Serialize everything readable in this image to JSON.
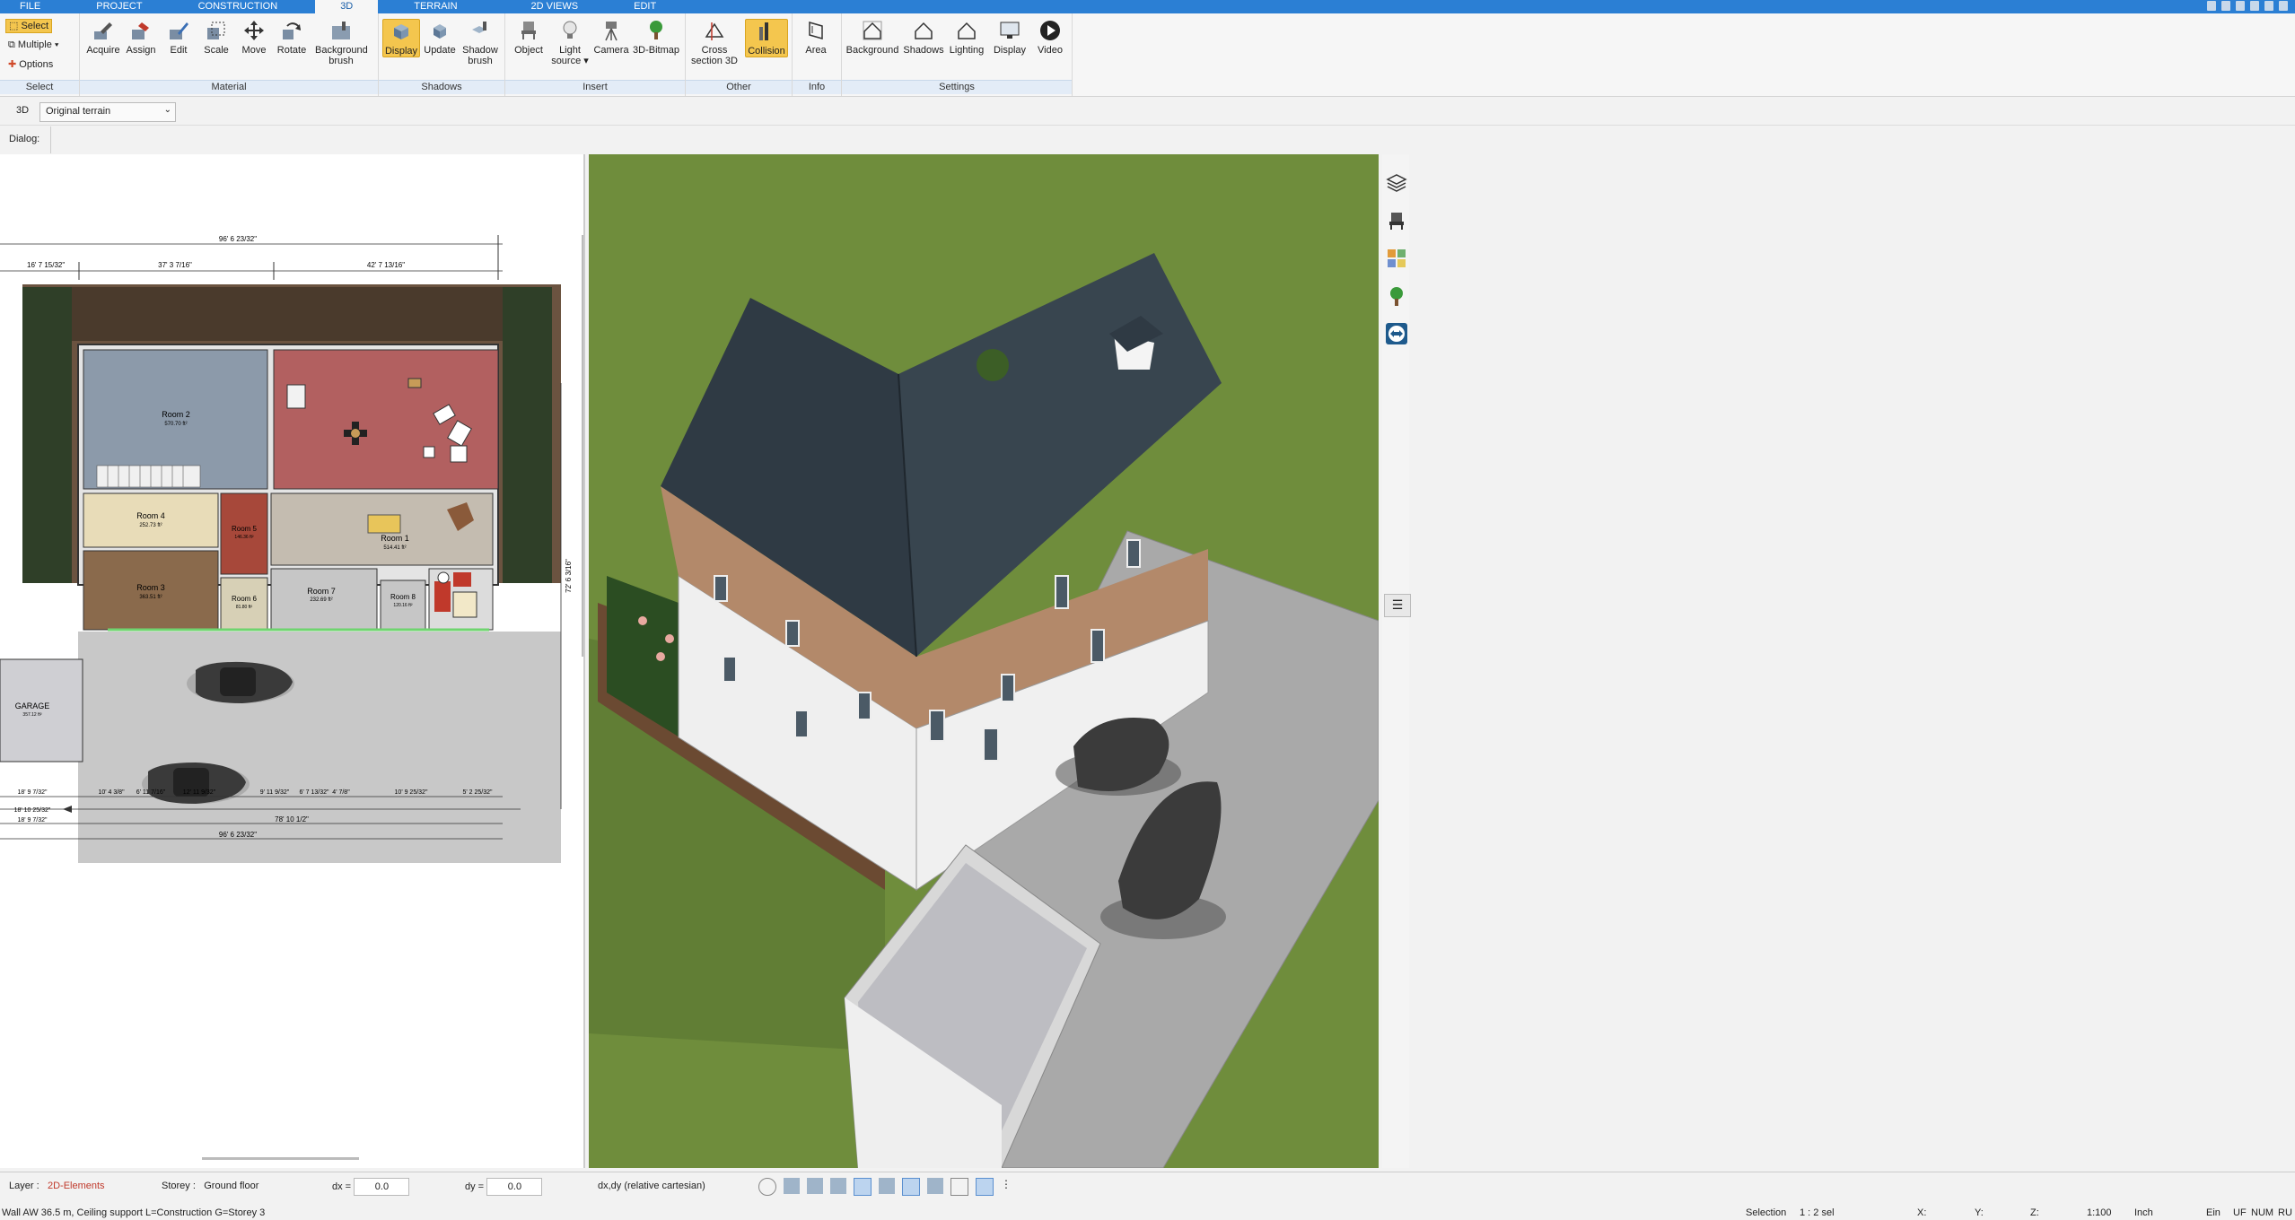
{
  "menu": {
    "tabs": [
      "FILE",
      "PROJECT",
      "CONSTRUCTION",
      "3D",
      "TERRAIN",
      "2D VIEWS",
      "EDIT"
    ],
    "active": "3D"
  },
  "ribbon": {
    "select_group": {
      "label": "Select",
      "select": "Select",
      "multiple": "Multiple",
      "options": "Options"
    },
    "material_group": {
      "label": "Material",
      "buttons": [
        "Acquire",
        "Assign",
        "Edit",
        "Scale",
        "Move",
        "Rotate",
        "Background brush"
      ]
    },
    "shadows_group": {
      "label": "Shadows",
      "buttons": [
        "Display",
        "Update",
        "Shadow brush"
      ]
    },
    "insert_group": {
      "label": "Insert",
      "buttons": [
        "Object",
        "Light source",
        "Camera",
        "3D-Bitmap"
      ]
    },
    "other_group": {
      "label": "Other",
      "buttons": [
        "Cross section 3D",
        "Collision"
      ]
    },
    "info_group": {
      "label": "Info",
      "buttons": [
        "Area"
      ]
    },
    "settings_group": {
      "label": "Settings",
      "buttons": [
        "Background",
        "Shadows",
        "Lighting",
        "Display",
        "Video"
      ]
    }
  },
  "subbar": {
    "mode": "3D",
    "terrain_select": "Original terrain"
  },
  "dialog": {
    "label": "Dialog:"
  },
  "plan": {
    "rooms": [
      {
        "name": "Room 2",
        "area": "570.70 ft²"
      },
      {
        "name": "Room 4",
        "area": "252.73 ft²"
      },
      {
        "name": "Room 3",
        "area": "363.51 ft²"
      },
      {
        "name": "Room 1",
        "area": "514.41 ft²"
      },
      {
        "name": "Room 5",
        "area": "146.36 ft²"
      },
      {
        "name": "Room 6",
        "area": "81.80 ft²"
      },
      {
        "name": "Room 7",
        "area": "232.69 ft²"
      },
      {
        "name": "Room 8",
        "area": "120.16 ft²"
      },
      {
        "name": "GARAGE",
        "area": "357.12 ft²"
      }
    ],
    "dims": {
      "top_total": "96' 6 23/32\"",
      "top_left": "37' 3 7/16\"",
      "top_right": "42' 7 13/16\"",
      "top_far_left": "16' 7 15/32\"",
      "right_height": "72' 6 3/16\"",
      "bottom_total": "96' 6 23/32\"",
      "bottom_mid": "78' 10 1/2\"",
      "bottom_left_1": "18' 9 7/32\"",
      "bottom_left_2": "18' 10 25/32\"",
      "bottom_left_3": "18' 9 7/32\"",
      "b1": "10' 4 3/8\"",
      "b2": "6' 11 7/16\"",
      "b3": "12' 11 9/32\"",
      "b4": "9' 11 9/32\"",
      "b5": "6' 7 13/32\"",
      "b6": "4' 7/8\"",
      "b7": "10' 9 25/32\"",
      "b8": "5' 2 25/32\""
    }
  },
  "statusbar": {
    "layer_label": "Layer :",
    "layer_value": "2D-Elements",
    "storey_label": "Storey :",
    "storey_value": "Ground floor",
    "dx_label": "dx =",
    "dx_value": "0.0",
    "dy_label": "dy =",
    "dy_value": "0.0",
    "coord_mode": "dx,dy (relative cartesian)"
  },
  "bottom": {
    "info": "Wall AW 36.5 m, Ceiling support L=Construction G=Storey 3",
    "selection_label": "Selection",
    "selection_value": "1 : 2 sel",
    "x": "X:",
    "y": "Y:",
    "z": "Z:",
    "scale": "1:100",
    "unit": "Inch",
    "ein": "Ein",
    "uf": "UF",
    "num": "NUM",
    "ru": "RU"
  },
  "colors": {
    "accent": "#2b7fd4",
    "active_btn": "#f4c64e",
    "grass": "#6c8a3a",
    "roof": "#2f3a44"
  }
}
